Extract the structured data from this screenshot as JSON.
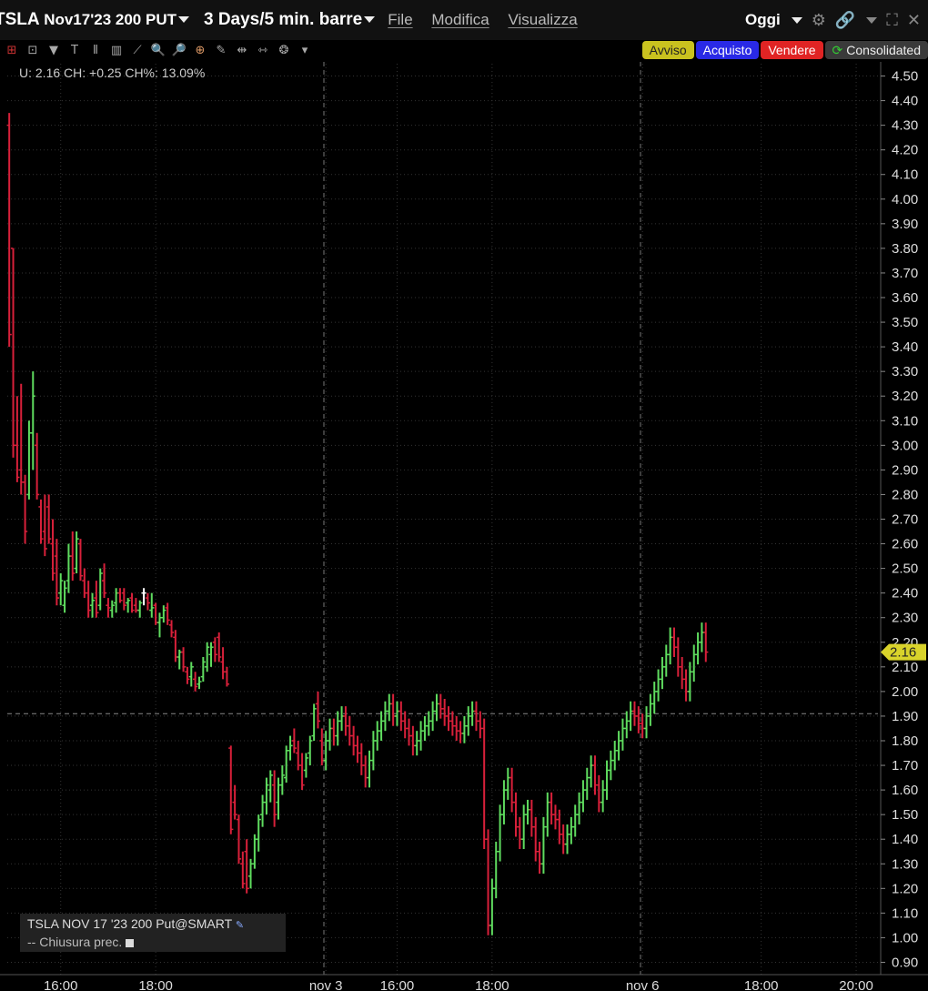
{
  "header": {
    "symbol": "TSLA",
    "contract": "Nov17'23 200 PUT",
    "period": "3 Days/5 min. barre",
    "menu": [
      "File",
      "Modifica",
      "Visualizza"
    ],
    "range": "Oggi"
  },
  "icons": [
    "dropdown-icon",
    "gear-icon",
    "link-icon",
    "expand-icon",
    "close-icon"
  ],
  "toolbar_buttons": {
    "avviso": "Avviso",
    "acquisto": "Acquisto",
    "vendere": "Vendere",
    "consolidated": "Consolidated"
  },
  "colors": {
    "up": "#5fdc5f",
    "down": "#d8203a",
    "neutral": "#ffffff",
    "price_tag": "#d9d32b",
    "avviso": "#c9c21f",
    "acquisto": "#2929e6",
    "vendere": "#e02424"
  },
  "info_line": "U: 2.16 CH: +0.25 CH%: 13.09%",
  "legend": {
    "series": "TSLA NOV 17 '23 200 Put@SMART",
    "prev_close_label": "Chiusura prec."
  },
  "chart_data": {
    "type": "ohlc",
    "ylim": [
      0.85,
      4.55
    ],
    "y_ticks": [
      0.9,
      1.0,
      1.1,
      1.2,
      1.3,
      1.4,
      1.5,
      1.6,
      1.7,
      1.8,
      1.9,
      2.0,
      2.1,
      2.2,
      2.3,
      2.4,
      2.5,
      2.6,
      2.7,
      2.8,
      2.9,
      3.0,
      3.1,
      3.2,
      3.3,
      3.4,
      3.5,
      3.6,
      3.7,
      3.8,
      3.9,
      4.0,
      4.1,
      4.2,
      4.3,
      4.4,
      4.5
    ],
    "x_labels": [
      {
        "label": "16:00",
        "bar": 13
      },
      {
        "label": "18:00",
        "bar": 37
      },
      {
        "label": "nov 3",
        "bar": 80
      },
      {
        "label": "16:00",
        "bar": 98
      },
      {
        "label": "18:00",
        "bar": 122
      },
      {
        "label": "nov 6",
        "bar": 160
      },
      {
        "label": "18:00",
        "bar": 190
      },
      {
        "label": "20:00",
        "bar": 214
      }
    ],
    "session_breaks": [
      80,
      160
    ],
    "last_price": 2.16,
    "prev_close": 1.91,
    "bars": [
      [
        4.3,
        4.35,
        3.4,
        3.45
      ],
      [
        3.8,
        3.8,
        2.95,
        3.0
      ],
      [
        3.0,
        3.2,
        2.85,
        2.87
      ],
      [
        2.9,
        3.25,
        2.8,
        2.85
      ],
      [
        2.85,
        2.88,
        2.6,
        2.65
      ],
      [
        2.8,
        3.1,
        2.78,
        3.05
      ],
      [
        3.05,
        3.3,
        2.9,
        3.2
      ],
      [
        3.0,
        3.05,
        2.78,
        2.8
      ],
      [
        2.75,
        2.78,
        2.6,
        2.62
      ],
      [
        2.65,
        2.8,
        2.55,
        2.58
      ],
      [
        2.75,
        2.8,
        2.6,
        2.62
      ],
      [
        2.6,
        2.7,
        2.45,
        2.48
      ],
      [
        2.55,
        2.62,
        2.35,
        2.38
      ],
      [
        2.4,
        2.48,
        2.35,
        2.45
      ],
      [
        2.35,
        2.45,
        2.32,
        2.42
      ],
      [
        2.45,
        2.6,
        2.4,
        2.55
      ],
      [
        2.55,
        2.65,
        2.45,
        2.48
      ],
      [
        2.5,
        2.65,
        2.48,
        2.62
      ],
      [
        2.6,
        2.62,
        2.45,
        2.47
      ],
      [
        2.45,
        2.5,
        2.38,
        2.4
      ],
      [
        2.4,
        2.45,
        2.3,
        2.33
      ],
      [
        2.35,
        2.4,
        2.3,
        2.37
      ],
      [
        2.38,
        2.45,
        2.3,
        2.32
      ],
      [
        2.35,
        2.5,
        2.33,
        2.48
      ],
      [
        2.45,
        2.52,
        2.38,
        2.4
      ],
      [
        2.35,
        2.38,
        2.3,
        2.34
      ],
      [
        2.33,
        2.37,
        2.3,
        2.35
      ],
      [
        2.36,
        2.42,
        2.32,
        2.4
      ],
      [
        2.4,
        2.42,
        2.36,
        2.37
      ],
      [
        2.4,
        2.42,
        2.33,
        2.35
      ],
      [
        2.36,
        2.38,
        2.32,
        2.37
      ],
      [
        2.38,
        2.4,
        2.32,
        2.33
      ],
      [
        2.35,
        2.38,
        2.32,
        2.33
      ],
      [
        2.33,
        2.37,
        2.3,
        2.36
      ],
      [
        2.4,
        2.42,
        2.35,
        2.4
      ],
      [
        2.38,
        2.4,
        2.33,
        2.36
      ],
      [
        2.33,
        2.4,
        2.3,
        2.34
      ],
      [
        2.35,
        2.36,
        2.27,
        2.28
      ],
      [
        2.28,
        2.32,
        2.22,
        2.3
      ],
      [
        2.3,
        2.35,
        2.28,
        2.33
      ],
      [
        2.34,
        2.36,
        2.27,
        2.29
      ],
      [
        2.27,
        2.29,
        2.22,
        2.24
      ],
      [
        2.22,
        2.25,
        2.12,
        2.14
      ],
      [
        2.14,
        2.17,
        2.09,
        2.16
      ],
      [
        2.16,
        2.18,
        2.08,
        2.1
      ],
      [
        2.08,
        2.1,
        2.03,
        2.05
      ],
      [
        2.06,
        2.12,
        2.02,
        2.1
      ],
      [
        2.05,
        2.08,
        2.0,
        2.02
      ],
      [
        2.03,
        2.06,
        2.01,
        2.04
      ],
      [
        2.06,
        2.14,
        2.04,
        2.12
      ],
      [
        2.1,
        2.2,
        2.08,
        2.18
      ],
      [
        2.15,
        2.2,
        2.1,
        2.18
      ],
      [
        2.2,
        2.22,
        2.12,
        2.15
      ],
      [
        2.22,
        2.24,
        2.12,
        2.14
      ],
      [
        2.12,
        2.18,
        2.05,
        2.08
      ],
      [
        2.08,
        2.1,
        2.02,
        2.03
      ],
      [
        1.77,
        1.78,
        1.42,
        1.44
      ],
      [
        1.55,
        1.62,
        1.48,
        1.5
      ],
      [
        1.48,
        1.5,
        1.3,
        1.32
      ],
      [
        1.3,
        1.35,
        1.2,
        1.22
      ],
      [
        1.35,
        1.4,
        1.18,
        1.2
      ],
      [
        1.25,
        1.32,
        1.2,
        1.3
      ],
      [
        1.3,
        1.42,
        1.28,
        1.4
      ],
      [
        1.4,
        1.5,
        1.35,
        1.48
      ],
      [
        1.5,
        1.58,
        1.45,
        1.55
      ],
      [
        1.55,
        1.65,
        1.5,
        1.62
      ],
      [
        1.6,
        1.68,
        1.55,
        1.66
      ],
      [
        1.62,
        1.68,
        1.45,
        1.5
      ],
      [
        1.55,
        1.65,
        1.48,
        1.62
      ],
      [
        1.62,
        1.7,
        1.58,
        1.66
      ],
      [
        1.65,
        1.78,
        1.63,
        1.76
      ],
      [
        1.76,
        1.82,
        1.72,
        1.78
      ],
      [
        1.8,
        1.85,
        1.75,
        1.77
      ],
      [
        1.75,
        1.8,
        1.68,
        1.7
      ],
      [
        1.7,
        1.75,
        1.6,
        1.62
      ],
      [
        1.68,
        1.75,
        1.65,
        1.73
      ],
      [
        1.75,
        1.82,
        1.7,
        1.8
      ],
      [
        1.82,
        1.95,
        1.8,
        1.93
      ],
      [
        1.95,
        2.0,
        1.85,
        1.88
      ],
      [
        1.8,
        1.85,
        1.7,
        1.72
      ]
    ]
  }
}
